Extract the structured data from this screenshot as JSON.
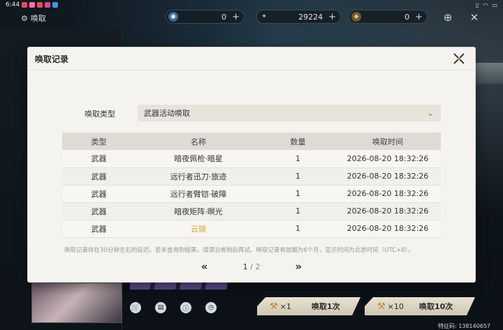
{
  "status_bar": {
    "time": "6:44",
    "notification_colors": [
      "#e84a5f",
      "#ff6fa5",
      "#e84a5f",
      "#d94b8a",
      "#4a90e2"
    ]
  },
  "header": {
    "page_title": "唤取",
    "currencies": [
      {
        "icon": "lustrous-tide-icon",
        "value": "0"
      },
      {
        "icon": "astrite-icon",
        "value": "29224"
      },
      {
        "icon": "forging-tide-icon",
        "value": "0"
      }
    ]
  },
  "dialog": {
    "title": "唤取记录",
    "filter": {
      "label": "唤取类型",
      "selected": "武器活动唤取"
    },
    "table": {
      "headers": [
        "类型",
        "名称",
        "数量",
        "唤取时间"
      ],
      "rows": [
        {
          "type": "武器",
          "name": "暗夜佩枪·暗星",
          "qty": "1",
          "time": "2026-08-20 18:32:26",
          "highlight": false
        },
        {
          "type": "武器",
          "name": "远行者迅刀·旅迹",
          "qty": "1",
          "time": "2026-08-20 18:32:26",
          "highlight": false
        },
        {
          "type": "武器",
          "name": "远行者臂铠·破障",
          "qty": "1",
          "time": "2026-08-20 18:32:26",
          "highlight": false
        },
        {
          "type": "武器",
          "name": "暗夜矩阵·暝光",
          "qty": "1",
          "time": "2026-08-20 18:32:26",
          "highlight": false
        },
        {
          "type": "武器",
          "name": "云琅",
          "qty": "1",
          "time": "2026-08-20 18:32:26",
          "highlight": true
        }
      ],
      "highlight_color": "#d9a22b"
    },
    "notice": "唤取记录存在30分钟左右的延迟。若未查询到结果，请漂泊者稍后再试。唤取记录有效期为6个月，显示时间为北京时间（UTC+8）。",
    "pagination": {
      "current": "1",
      "separator": "/",
      "total": "2"
    }
  },
  "bottom": {
    "summon_once": {
      "cost": "×1",
      "label": "唤取1次"
    },
    "summon_ten": {
      "cost": "×10",
      "label": "唤取10次"
    },
    "uid_text": "特征码: 138140657"
  }
}
